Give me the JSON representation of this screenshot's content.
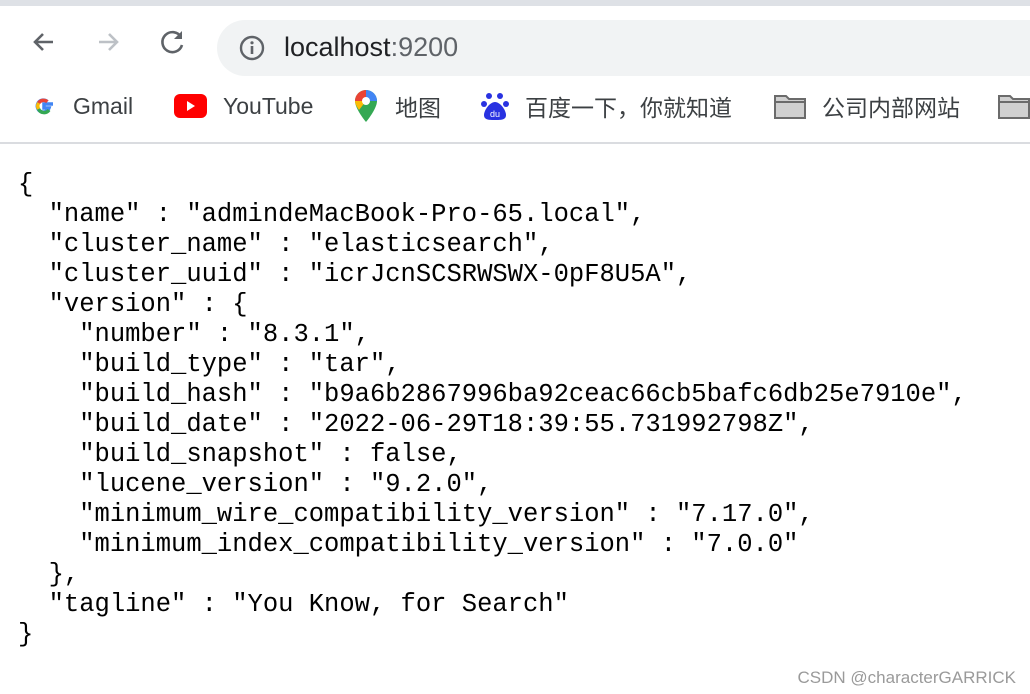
{
  "browser": {
    "url_host": "localhost",
    "url_port": ":9200",
    "bookmarks": [
      {
        "label": "Gmail",
        "icon": "google-icon"
      },
      {
        "label": "YouTube",
        "icon": "youtube-icon"
      },
      {
        "label": "地图",
        "icon": "maps-pin-icon"
      },
      {
        "label": "百度一下，你就知道",
        "icon": "baidu-paw-icon"
      },
      {
        "label": "公司内部网站",
        "icon": "folder-icon"
      }
    ]
  },
  "content": {
    "lines": [
      "{",
      "  \"name\" : \"admindeMacBook-Pro-65.local\",",
      "  \"cluster_name\" : \"elasticsearch\",",
      "  \"cluster_uuid\" : \"icrJcnSCSRWSWX-0pF8U5A\",",
      "  \"version\" : {",
      "    \"number\" : \"8.3.1\",",
      "    \"build_type\" : \"tar\",",
      "    \"build_hash\" : \"b9a6b2867996ba92ceac66cb5bafc6db25e7910e\",",
      "    \"build_date\" : \"2022-06-29T18:39:55.731992798Z\",",
      "    \"build_snapshot\" : false,",
      "    \"lucene_version\" : \"9.2.0\",",
      "    \"minimum_wire_compatibility_version\" : \"7.17.0\",",
      "    \"minimum_index_compatibility_version\" : \"7.0.0\"",
      "  },",
      "  \"tagline\" : \"You Know, for Search\"",
      "}"
    ]
  },
  "watermark": "CSDN @characterGARRICK"
}
